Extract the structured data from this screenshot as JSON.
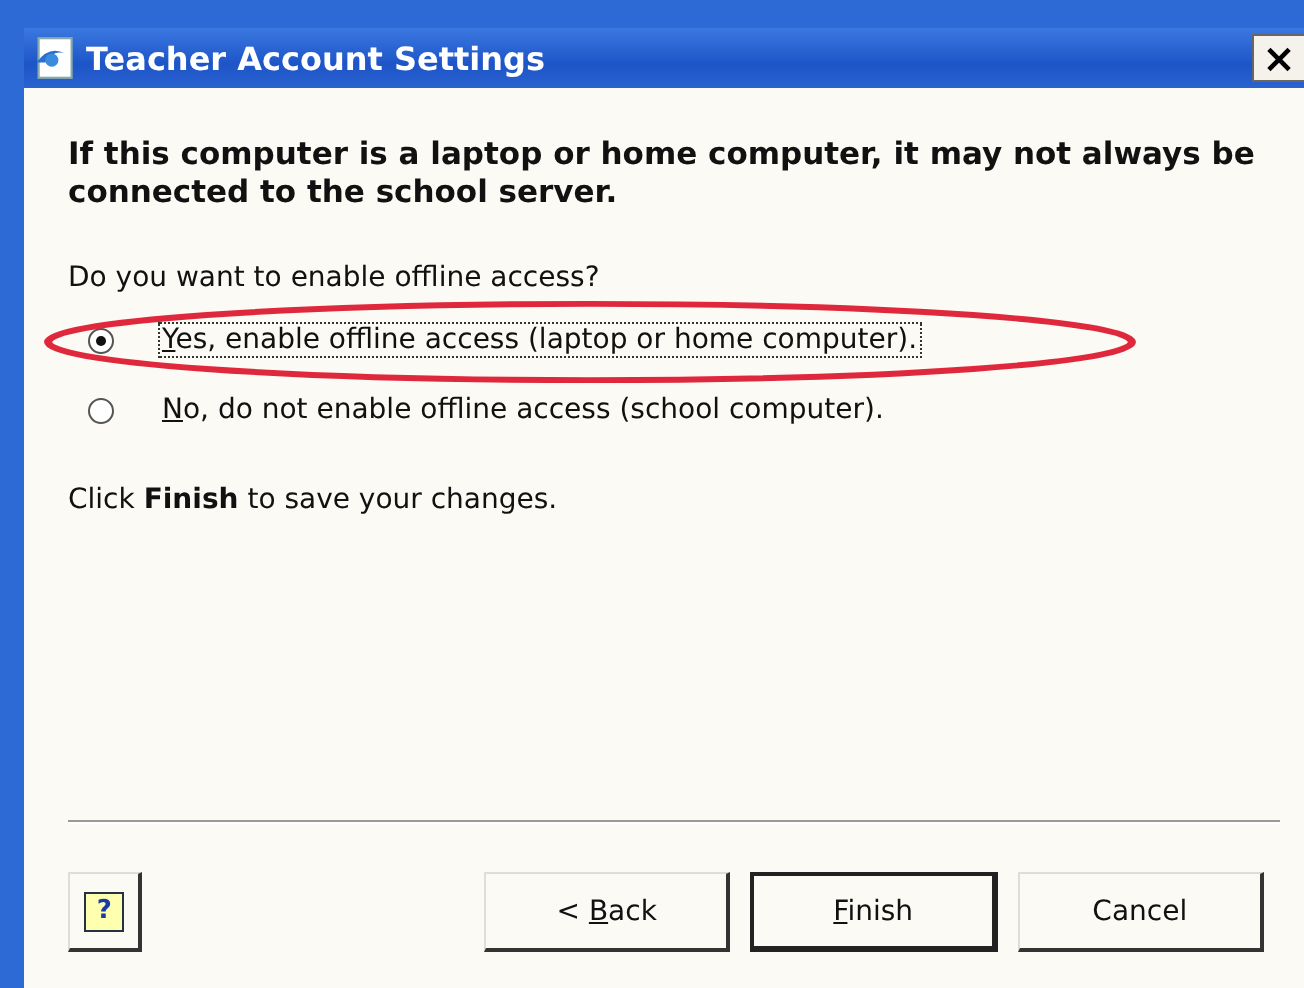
{
  "window": {
    "title": "Teacher Account Settings",
    "close": "×"
  },
  "heading": "If this computer is a laptop or home computer, it may not always be connected to the school server.",
  "question": "Do you want to enable offline access?",
  "options": [
    {
      "label": "Yes, enable offline access (laptop or home computer).",
      "mnemonic": true,
      "selected": true,
      "focused": true,
      "circled": true
    },
    {
      "label": "No, do not enable offline access (school computer).",
      "mnemonic": true,
      "selected": false,
      "focused": false,
      "circled": false
    }
  ],
  "note": "Click **Finish** to save your changes.",
  "buttons": [
    {
      "kind": "help",
      "label": "?"
    },
    {
      "kind": "normal",
      "label": "< Back",
      "mnemonic": true,
      "default": false
    },
    {
      "kind": "normal",
      "label": "Finish",
      "mnemonic": true,
      "default": true
    },
    {
      "kind": "normal",
      "label": "Cancel",
      "default": false
    }
  ]
}
